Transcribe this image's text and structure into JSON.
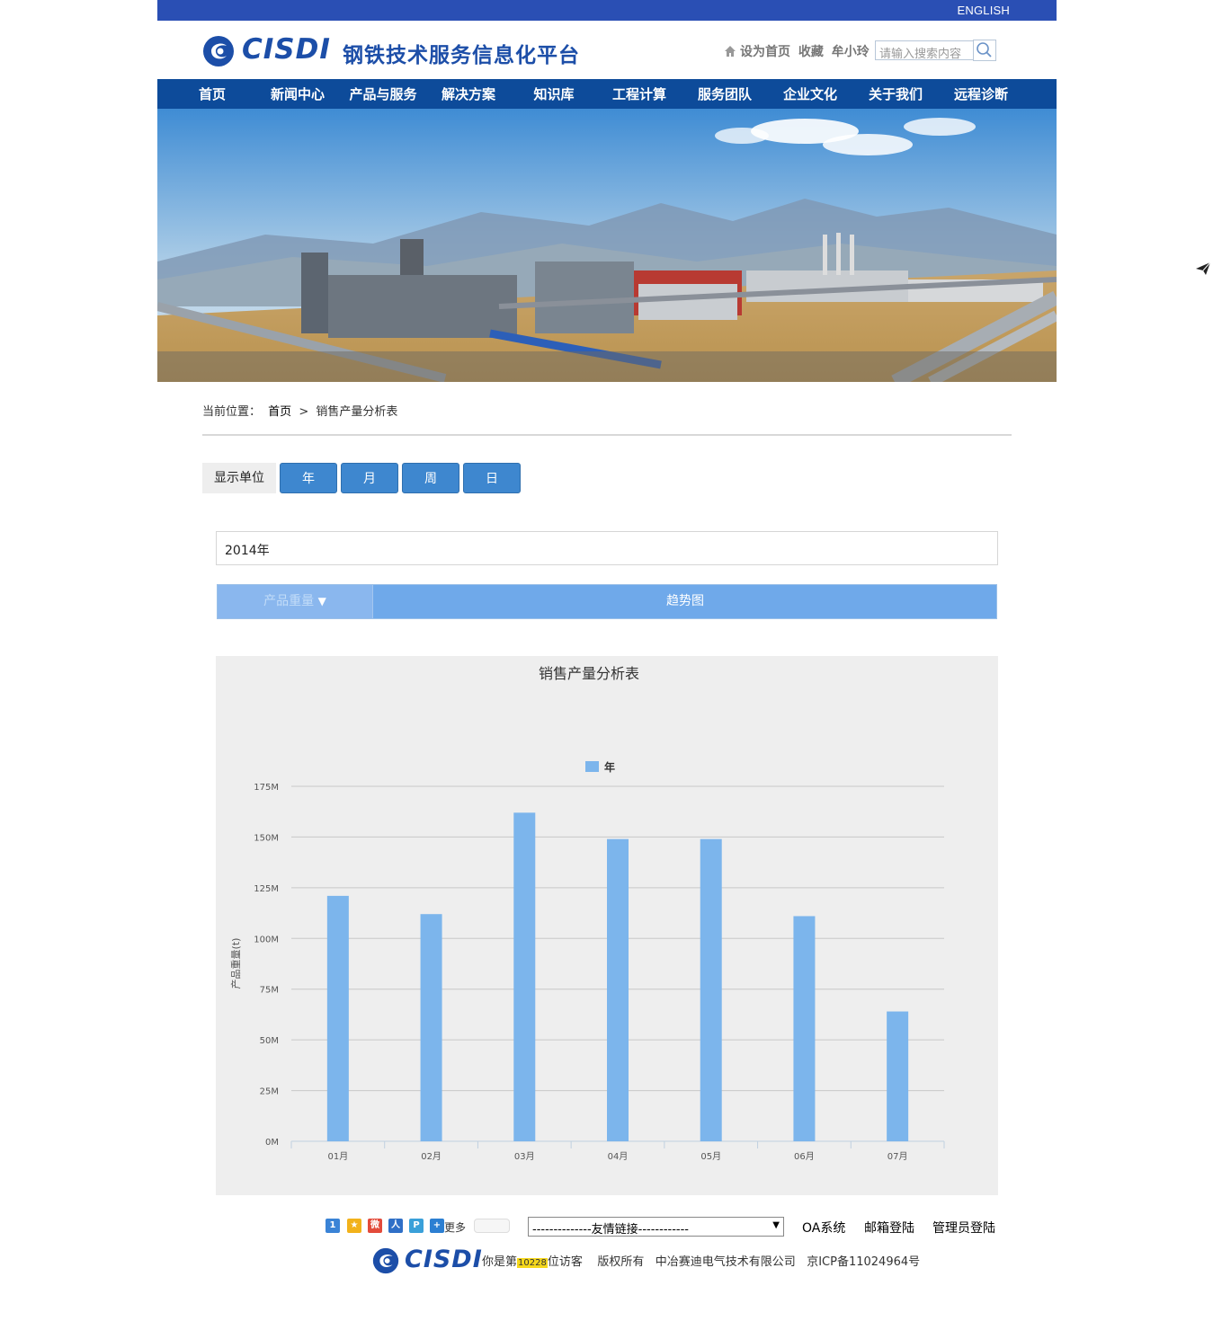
{
  "topbar": {
    "english_link": "ENGLISH"
  },
  "header": {
    "logo_text": "CISDI",
    "site_title": "钢铁技术服务信息化平台",
    "set_home": "设为首页",
    "bookmark": "收藏",
    "user": "牟小玲",
    "search_placeholder": "请输入搜索内容"
  },
  "nav": {
    "items": [
      {
        "label": "首页"
      },
      {
        "label": "新闻中心"
      },
      {
        "label": "产品与服务"
      },
      {
        "label": "解决方案"
      },
      {
        "label": "知识库"
      },
      {
        "label": "工程计算"
      },
      {
        "label": "服务团队"
      },
      {
        "label": "企业文化"
      },
      {
        "label": "关于我们"
      },
      {
        "label": "远程诊断"
      }
    ]
  },
  "breadcrumb": {
    "prefix": "当前位置：",
    "home": "首页",
    "sep": ">",
    "current": "销售产量分析表"
  },
  "units": {
    "label": "显示单位",
    "buttons": [
      "年",
      "月",
      "周",
      "日"
    ]
  },
  "year_selector": {
    "value": "2014年"
  },
  "tabs": {
    "weight": "产品重量",
    "weight_arrow": "▼",
    "trend": "趋势图"
  },
  "chart_data": {
    "type": "bar",
    "title": "销售产量分析表",
    "legend": [
      "年"
    ],
    "legend_position": "top-center",
    "ylabel": "产品重量(t)",
    "xlabel": "",
    "categories": [
      "01月",
      "02月",
      "03月",
      "04月",
      "05月",
      "06月",
      "07月"
    ],
    "series": [
      {
        "name": "年",
        "values": [
          121,
          112,
          162,
          149,
          149,
          111,
          64
        ]
      }
    ],
    "ylim": [
      0,
      175
    ],
    "yticks": [
      "0M",
      "25M",
      "50M",
      "75M",
      "100M",
      "125M",
      "150M",
      "175M"
    ],
    "grid": true,
    "bar_color": "#7cb5ec"
  },
  "footer": {
    "share_more": "更多",
    "friend_links": "--------------友情链接------------",
    "oa": "OA系统",
    "mail": "邮箱登陆",
    "admin": "管理员登陆",
    "logo_text": "CISDI",
    "visitor_prefix": "你是第",
    "visitor_count": "10228",
    "visitor_suffix": "位访客",
    "copyright": "版权所有",
    "company": "中冶赛迪电气技术有限公司",
    "icp": "京ICP备11024964号"
  },
  "colors": {
    "topbar": "#2a4fb4",
    "nav": "#0d4b9a",
    "accent_button": "#3e87cf",
    "bar": "#7cb5ec"
  }
}
